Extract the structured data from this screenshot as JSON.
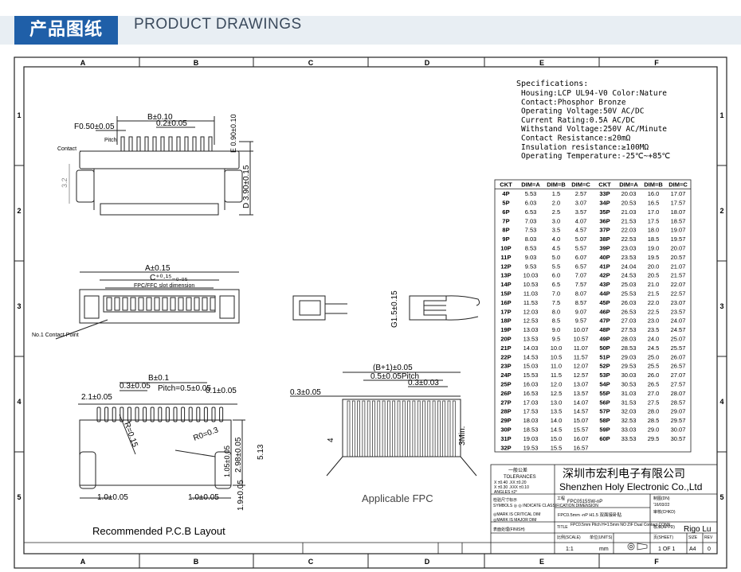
{
  "banner": {
    "title_cn": "产品图纸",
    "title_en": "PRODUCT DRAWINGS"
  },
  "frame": {
    "cols": [
      "A",
      "B",
      "C",
      "D",
      "E",
      "F"
    ],
    "rows": [
      "1",
      "2",
      "3",
      "4",
      "5"
    ]
  },
  "specs": {
    "heading": "Specifications:",
    "lines": [
      "Housing:LCP UL94-V0 Color:Nature",
      "Contact:Phosphor Bronze",
      "Operating Voltage:50V AC/DC",
      "Current Rating:0.5A AC/DC",
      "Withstand Voltage:250V AC/Minute",
      "Contact Resistance:≤20mΩ",
      "Insulation resistance:≥100MΩ",
      "Operating Temperature:-25℃~+85℃"
    ]
  },
  "table": {
    "headers": [
      "CKT",
      "DIM=A",
      "DIM=B",
      "DIM=C",
      "CKT",
      "DIM=A",
      "DIM=B",
      "DIM=C"
    ],
    "left": [
      [
        "4P",
        "5.53",
        "1.5",
        "2.57"
      ],
      [
        "5P",
        "6.03",
        "2.0",
        "3.07"
      ],
      [
        "6P",
        "6.53",
        "2.5",
        "3.57"
      ],
      [
        "7P",
        "7.03",
        "3.0",
        "4.07"
      ],
      [
        "8P",
        "7.53",
        "3.5",
        "4.57"
      ],
      [
        "9P",
        "8.03",
        "4.0",
        "5.07"
      ],
      [
        "10P",
        "8.53",
        "4.5",
        "5.57"
      ],
      [
        "11P",
        "9.03",
        "5.0",
        "6.07"
      ],
      [
        "12P",
        "9.53",
        "5.5",
        "6.57"
      ],
      [
        "13P",
        "10.03",
        "6.0",
        "7.07"
      ],
      [
        "14P",
        "10.53",
        "6.5",
        "7.57"
      ],
      [
        "15P",
        "11.03",
        "7.0",
        "8.07"
      ],
      [
        "16P",
        "11.53",
        "7.5",
        "8.57"
      ],
      [
        "17P",
        "12.03",
        "8.0",
        "9.07"
      ],
      [
        "18P",
        "12.53",
        "8.5",
        "9.57"
      ],
      [
        "19P",
        "13.03",
        "9.0",
        "10.07"
      ],
      [
        "20P",
        "13.53",
        "9.5",
        "10.57"
      ],
      [
        "21P",
        "14.03",
        "10.0",
        "11.07"
      ],
      [
        "22P",
        "14.53",
        "10.5",
        "11.57"
      ],
      [
        "23P",
        "15.03",
        "11.0",
        "12.07"
      ],
      [
        "24P",
        "15.53",
        "11.5",
        "12.57"
      ],
      [
        "25P",
        "16.03",
        "12.0",
        "13.07"
      ],
      [
        "26P",
        "16.53",
        "12.5",
        "13.57"
      ],
      [
        "27P",
        "17.03",
        "13.0",
        "14.07"
      ],
      [
        "28P",
        "17.53",
        "13.5",
        "14.57"
      ],
      [
        "29P",
        "18.03",
        "14.0",
        "15.07"
      ],
      [
        "30P",
        "18.53",
        "14.5",
        "15.57"
      ],
      [
        "31P",
        "19.03",
        "15.0",
        "16.07"
      ],
      [
        "32P",
        "19.53",
        "15.5",
        "16.57"
      ]
    ],
    "right": [
      [
        "33P",
        "20.03",
        "16.0",
        "17.07"
      ],
      [
        "34P",
        "20.53",
        "16.5",
        "17.57"
      ],
      [
        "35P",
        "21.03",
        "17.0",
        "18.07"
      ],
      [
        "36P",
        "21.53",
        "17.5",
        "18.57"
      ],
      [
        "37P",
        "22.03",
        "18.0",
        "19.07"
      ],
      [
        "38P",
        "22.53",
        "18.5",
        "19.57"
      ],
      [
        "39P",
        "23.03",
        "19.0",
        "20.07"
      ],
      [
        "40P",
        "23.53",
        "19.5",
        "20.57"
      ],
      [
        "41P",
        "24.04",
        "20.0",
        "21.07"
      ],
      [
        "42P",
        "24.53",
        "20.5",
        "21.57"
      ],
      [
        "43P",
        "25.03",
        "21.0",
        "22.07"
      ],
      [
        "44P",
        "25.53",
        "21.5",
        "22.57"
      ],
      [
        "45P",
        "26.03",
        "22.0",
        "23.07"
      ],
      [
        "46P",
        "26.53",
        "22.5",
        "23.57"
      ],
      [
        "47P",
        "27.03",
        "23.0",
        "24.07"
      ],
      [
        "48P",
        "27.53",
        "23.5",
        "24.57"
      ],
      [
        "49P",
        "28.03",
        "24.0",
        "25.07"
      ],
      [
        "50P",
        "28.53",
        "24.5",
        "25.57"
      ],
      [
        "51P",
        "29.03",
        "25.0",
        "26.07"
      ],
      [
        "52P",
        "29.53",
        "25.5",
        "26.57"
      ],
      [
        "53P",
        "30.03",
        "26.0",
        "27.07"
      ],
      [
        "54P",
        "30.53",
        "26.5",
        "27.57"
      ],
      [
        "55P",
        "31.03",
        "27.0",
        "28.07"
      ],
      [
        "56P",
        "31.53",
        "27.5",
        "28.57"
      ],
      [
        "57P",
        "32.03",
        "28.0",
        "29.07"
      ],
      [
        "58P",
        "32.53",
        "28.5",
        "29.57"
      ],
      [
        "59P",
        "33.03",
        "29.0",
        "30.07"
      ],
      [
        "60P",
        "33.53",
        "29.5",
        "30.57"
      ]
    ]
  },
  "dims": {
    "b010": "B±0.10",
    "f050": "F0.50±0.05",
    "p02": "0.2±0.05",
    "e090": "E 0.90±0.10",
    "d390": "D 3.90±0.15",
    "d32": "3.2",
    "pitch": "Pitch",
    "contact": "Contact",
    "a015": "A±0.15",
    "c005": "C⁺⁰·¹⁵₋₀.₀₅",
    "slot": "FPC/FFC slot dimension",
    "no1": "No.1 Contact Point",
    "g15": "G1.5±0.15",
    "b01": "B±0.1",
    "p03": "0.3±0.05",
    "pitchv": "Pitch=0.5±0.05",
    "v21": "2.1±0.05",
    "v01": "0.1±0.05",
    "r015": "R=0.15",
    "r03": "R0=0.3",
    "v105": "1.05±0.05",
    "v298": "2.98±0.05",
    "v513": "5.13",
    "v10a": "1.0±0.05",
    "v10b": "1.0±0.05",
    "v19": "1.9±0.05",
    "bp1": "(B+1)±0.05",
    "v05p": "0.5±0.05Pitch",
    "v03b": "0.3±0.05",
    "v03c": "0.3±0.03",
    "v03d": "0.3±0.05",
    "v4": "4",
    "v3min": "3Min."
  },
  "labels": {
    "pcb": "Recommended P.C.B Layout",
    "fpc": "Applicable FPC"
  },
  "title_block": {
    "tol_head": "一般公差",
    "tol_en": "TOLERANCES",
    "tol1": "X ±0.40  .XX ±0.20",
    "tol2": "X ±0.30  .XXX ±0.10",
    "tol3": "ANGLES ±2°",
    "company_cn": "深圳市宏利电子有限公司",
    "company_en": "Shenzhen Holy Electronic Co.,Ltd",
    "code_lbl": "工程",
    "code_val": "FPC0515SW-nP",
    "name_val": "FPC0.5mm -nP H1.5 双面接卧贴",
    "title_lbl": "TITLE",
    "title_val": "FPC0.5mm Pitch H=1.5mm NO ZIF Dual Contact CONN",
    "drawn_lbl": "制图(DN)",
    "date": "'16/03/22",
    "check_lbl": "审核(CHKD)",
    "appd_lbl": "核准(APPD)",
    "appd_val": "Rigo Lu",
    "scale_lbl": "比例(SCALE)",
    "scale_val": "1:1",
    "unit_lbl": "单位(UNITS)",
    "unit_val": "mm",
    "sheet_lbl": "页(SHEET)",
    "sheet_val": "1 OF 1",
    "size_lbl": "SIZE",
    "size_val": "A4",
    "rev_lbl": "REV",
    "rev_val": "0",
    "sym1": "检验尺寸标示",
    "sym2": "SYMBOLS ◎ ◎ INDICATE CLASSIFICATION DIMENSION",
    "crit": "◎MARK IS CRITICAL DIM",
    "major": "◎MARK IS MAJOR DIM",
    "finish": "表面处理(FINISH)"
  }
}
